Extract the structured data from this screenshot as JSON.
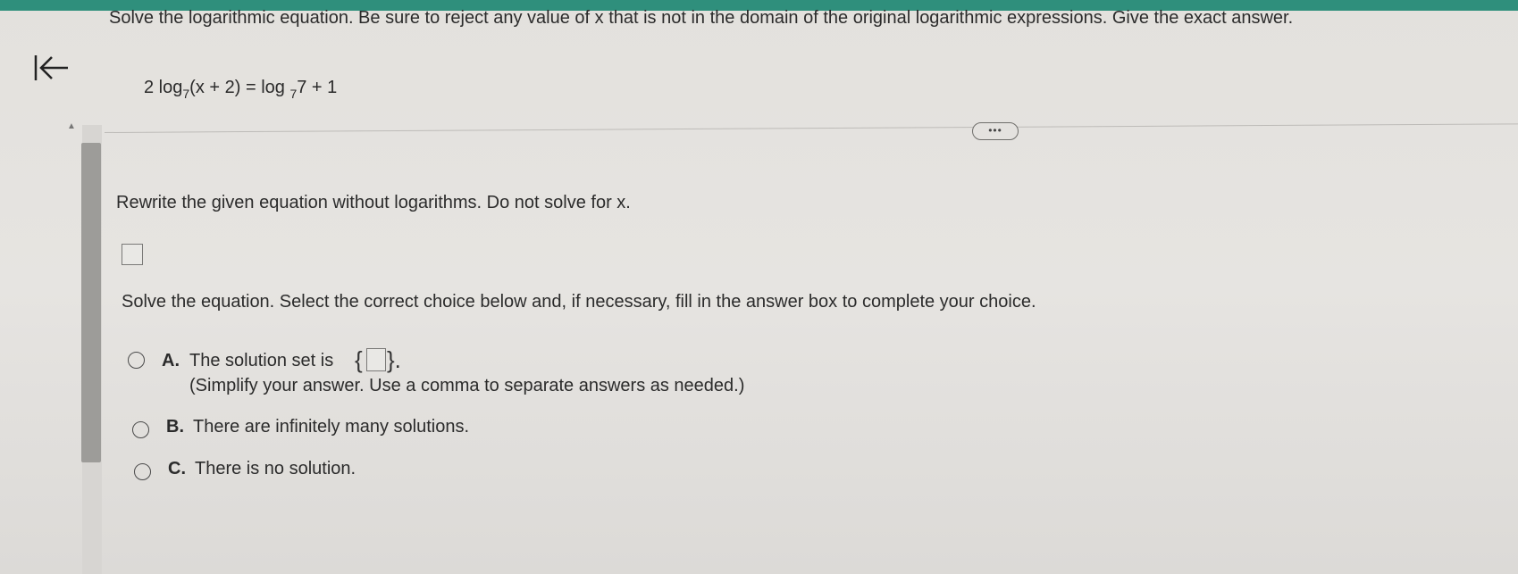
{
  "header": {
    "accent_color": "#2f8f7c"
  },
  "nav": {
    "back_icon": "arrow-left-to-bar-icon"
  },
  "question": {
    "instruction": "Solve the logarithmic equation. Be sure to reject any value of x that is not in the domain of the original logarithmic expressions. Give the exact answer.",
    "equation": {
      "coef": "2 log",
      "base1": "7",
      "arg1": "(x + 2) = log",
      "base2": "7",
      "rest": "7 + 1"
    }
  },
  "toggle": {
    "label": "•••"
  },
  "part1": {
    "prompt": "Rewrite the given equation without logarithms. Do not solve for x."
  },
  "part2": {
    "prompt": "Solve the equation. Select the correct choice below and, if necessary, fill in the answer box to complete your choice.",
    "options": [
      {
        "letter": "A.",
        "text": "The solution set is",
        "hint": "(Simplify your answer.  Use a comma to separate answers as needed.)"
      },
      {
        "letter": "B.",
        "text": "There are infinitely many solutions."
      },
      {
        "letter": "C.",
        "text": "There is no solution."
      }
    ],
    "braces": {
      "left": "{",
      "right": "}."
    }
  }
}
